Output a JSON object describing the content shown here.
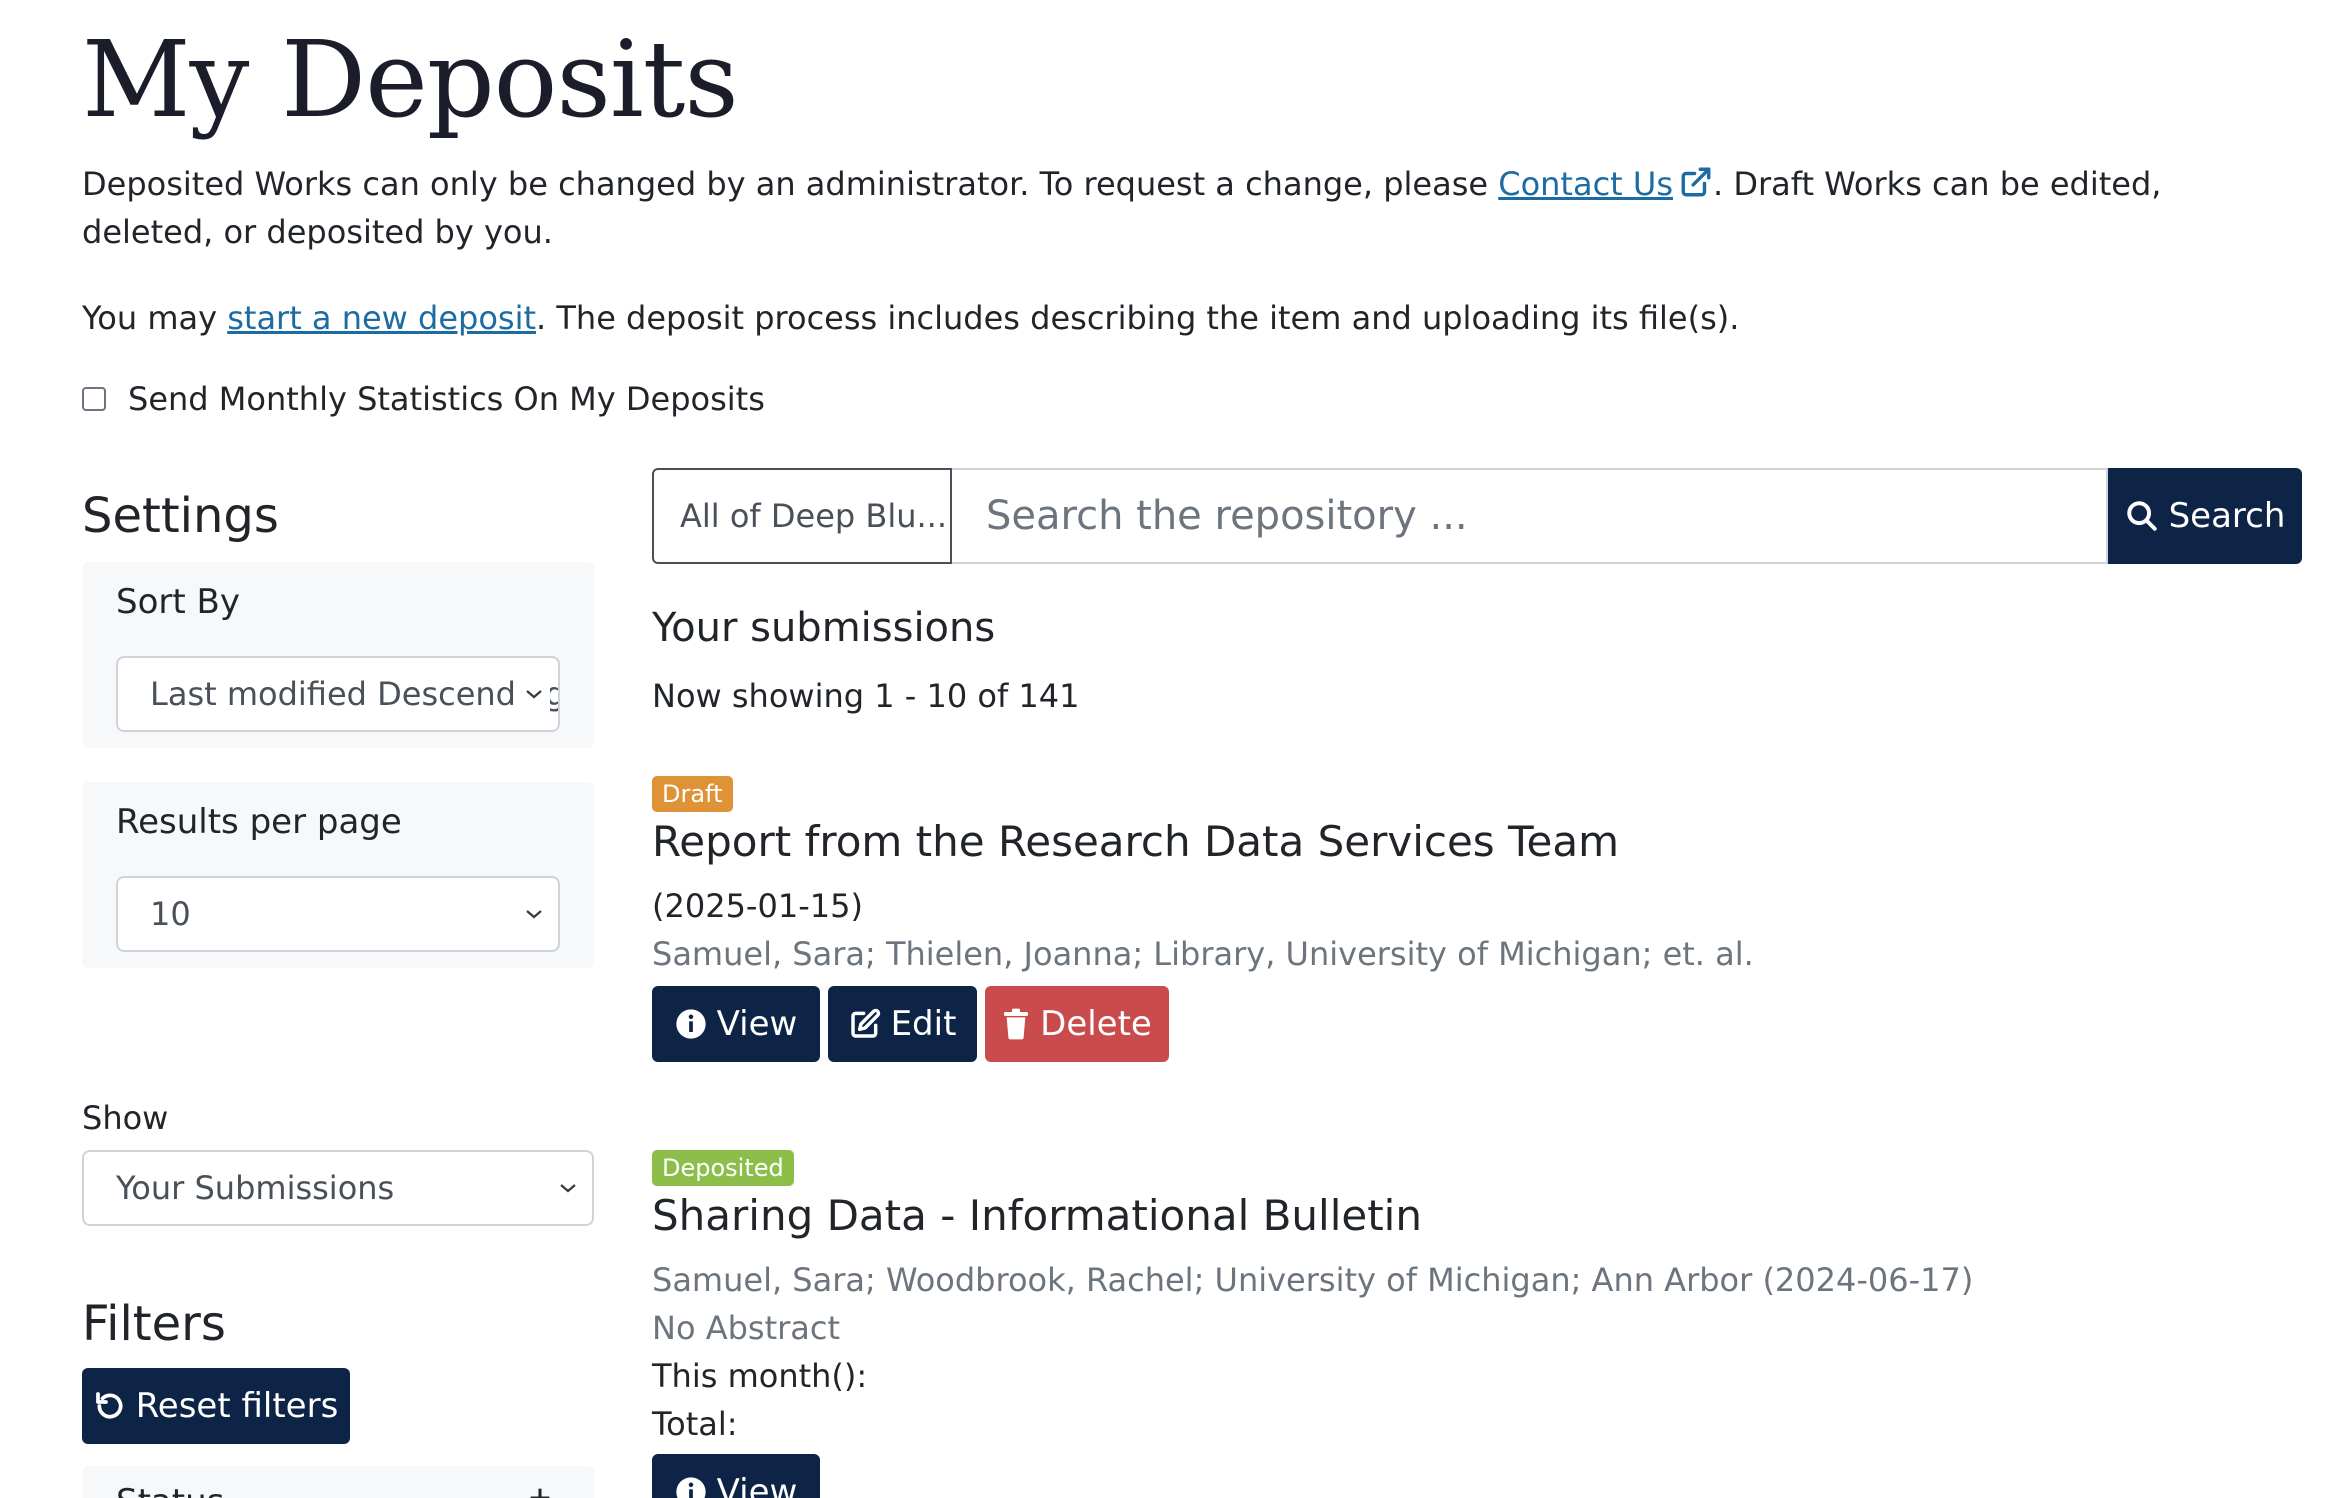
{
  "page": {
    "title": "My Deposits",
    "intro_part1": "Deposited Works can only be changed by an administrator. To request a change, please ",
    "contact_link": "Contact Us",
    "intro_part2": ". Draft Works can be edited, deleted, or deposited by you.",
    "may_prefix": "You may ",
    "new_deposit_link": "start a new deposit",
    "may_suffix": ". The deposit process includes describing the item and uploading its file(s).",
    "stats_checkbox_label": "Send Monthly Statistics On My Deposits",
    "stats_checked": false
  },
  "sidebar": {
    "settings_heading": "Settings",
    "sort_label": "Sort By",
    "sort_value": "Last modified Descending",
    "per_page_label": "Results per page",
    "per_page_value": "10",
    "show_label": "Show",
    "show_value": "Your Submissions",
    "filters_heading": "Filters",
    "reset_filters": "Reset filters",
    "facet_label": "Status"
  },
  "search": {
    "scope": "All of Deep Blu...",
    "placeholder": "Search the repository ...",
    "button": "Search"
  },
  "results": {
    "heading": "Your submissions",
    "showing": "Now showing 1 - 10 of 141",
    "items": [
      {
        "badge": "Draft",
        "title": "Report from the Research Data Services Team",
        "date": "(2025-01-15)",
        "authors": "Samuel, Sara; Thielen, Joanna; Library, University of Michigan; et. al.",
        "view": "View",
        "edit": "Edit",
        "delete": "Delete"
      },
      {
        "badge": "Deposited",
        "title": "Sharing Data - Informational Bulletin",
        "authors": "Samuel, Sara; Woodbrook, Rachel; University of Michigan; Ann Arbor (2024-06-17)",
        "abstract": "No Abstract",
        "this_month": "This month():",
        "total": "Total:",
        "view": "View"
      }
    ]
  },
  "colors": {
    "primary": "#0e2446",
    "danger": "#c94b4b",
    "draft": "#df9336",
    "deposited": "#8dbe4a",
    "link": "#1c6ca2"
  }
}
